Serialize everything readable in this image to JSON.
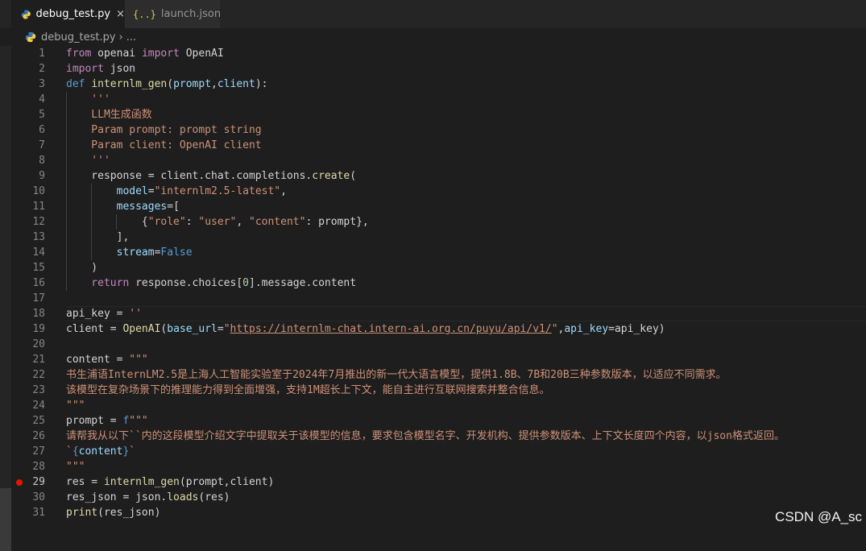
{
  "tabs": [
    {
      "label": "debug_test.py",
      "icon": "python-icon",
      "active": true
    },
    {
      "label": "launch.json",
      "icon": "json-braces-icon",
      "active": false
    }
  ],
  "tab_close_glyph": "×",
  "json_icon_glyph": "{..}",
  "breadcrumb": {
    "file": "debug_test.py",
    "separator": "›",
    "more": "..."
  },
  "colors": {
    "keyword": "#c586c0",
    "builtin_keyword": "#569cd6",
    "function": "#dcdcaa",
    "parameter": "#9cdcfe",
    "string": "#ce9178",
    "number": "#b5cea8",
    "breakpoint": "#e51400"
  },
  "breakpoint_line": 29,
  "current_line": 18,
  "lines": [
    {
      "n": "1",
      "indent": 0,
      "tokens": [
        [
          "kw",
          "from"
        ],
        [
          "",
          ""
        ],
        [
          "",
          "openai "
        ],
        [
          "kw",
          "import"
        ],
        [
          "",
          " OpenAI"
        ]
      ]
    },
    {
      "n": "2",
      "indent": 0,
      "tokens": [
        [
          "kw",
          "import"
        ],
        [
          "",
          " json"
        ]
      ]
    },
    {
      "n": "3",
      "indent": 0,
      "tokens": [
        [
          "kwb",
          "def"
        ],
        [
          "",
          " "
        ],
        [
          "fn",
          "internlm_gen"
        ],
        [
          "",
          "("
        ],
        [
          "par",
          "prompt"
        ],
        [
          "",
          ","
        ],
        [
          "par",
          "client"
        ],
        [
          "",
          "):"
        ]
      ]
    },
    {
      "n": "4",
      "indent": 1,
      "tokens": [
        [
          "str",
          "    '''"
        ]
      ]
    },
    {
      "n": "5",
      "indent": 1,
      "tokens": [
        [
          "str",
          "    LLM生成函数"
        ]
      ]
    },
    {
      "n": "6",
      "indent": 1,
      "tokens": [
        [
          "str",
          "    Param prompt: prompt string"
        ]
      ]
    },
    {
      "n": "7",
      "indent": 1,
      "tokens": [
        [
          "str",
          "    Param client: OpenAI client"
        ]
      ]
    },
    {
      "n": "8",
      "indent": 1,
      "tokens": [
        [
          "str",
          "    '''"
        ]
      ]
    },
    {
      "n": "9",
      "indent": 1,
      "tokens": [
        [
          "",
          "    response = client.chat.completions."
        ],
        [
          "fn",
          "create"
        ],
        [
          "",
          "("
        ]
      ]
    },
    {
      "n": "10",
      "indent": 2,
      "tokens": [
        [
          "",
          "        "
        ],
        [
          "par",
          "model"
        ],
        [
          "",
          "="
        ],
        [
          "str",
          "\"internlm2.5-latest\""
        ],
        [
          "",
          ","
        ]
      ]
    },
    {
      "n": "11",
      "indent": 2,
      "tokens": [
        [
          "",
          "        "
        ],
        [
          "par",
          "messages"
        ],
        [
          "",
          "=["
        ]
      ]
    },
    {
      "n": "12",
      "indent": 3,
      "tokens": [
        [
          "",
          "            {"
        ],
        [
          "str",
          "\"role\""
        ],
        [
          "",
          ": "
        ],
        [
          "str",
          "\"user\""
        ],
        [
          "",
          ", "
        ],
        [
          "str",
          "\"content\""
        ],
        [
          "",
          ": prompt},"
        ]
      ]
    },
    {
      "n": "13",
      "indent": 2,
      "tokens": [
        [
          "",
          "        ],"
        ]
      ]
    },
    {
      "n": "14",
      "indent": 2,
      "tokens": [
        [
          "",
          "        "
        ],
        [
          "par",
          "stream"
        ],
        [
          "",
          "="
        ],
        [
          "kwb",
          "False"
        ]
      ]
    },
    {
      "n": "15",
      "indent": 1,
      "tokens": [
        [
          "",
          "    )"
        ]
      ]
    },
    {
      "n": "16",
      "indent": 1,
      "tokens": [
        [
          "kw",
          "    return"
        ],
        [
          "",
          " response.choices["
        ],
        [
          "num",
          "0"
        ],
        [
          "",
          "].message.content"
        ]
      ]
    },
    {
      "n": "17",
      "indent": 0,
      "tokens": []
    },
    {
      "n": "18",
      "indent": 0,
      "tokens": [
        [
          "",
          "api_key = "
        ],
        [
          "str",
          "''"
        ]
      ]
    },
    {
      "n": "19",
      "indent": 0,
      "tokens": [
        [
          "",
          "client = "
        ],
        [
          "fn",
          "OpenAI"
        ],
        [
          "",
          "("
        ],
        [
          "par",
          "base_url"
        ],
        [
          "",
          "="
        ],
        [
          "str",
          "\""
        ],
        [
          "link",
          "https://internlm-chat.intern-ai.org.cn/puyu/api/v1/"
        ],
        [
          "str",
          "\""
        ],
        [
          "",
          ","
        ],
        [
          "par",
          "api_key"
        ],
        [
          "",
          "=api_key)"
        ]
      ]
    },
    {
      "n": "20",
      "indent": 0,
      "tokens": []
    },
    {
      "n": "21",
      "indent": 0,
      "tokens": [
        [
          "",
          "content = "
        ],
        [
          "str",
          "\"\"\""
        ]
      ]
    },
    {
      "n": "22",
      "indent": 0,
      "tokens": [
        [
          "str",
          "书生浦语InternLM2.5是上海人工智能实验室于2024年7月推出的新一代大语言模型，提供1.8B、7B和20B三种参数版本，以适应不同需求。"
        ]
      ]
    },
    {
      "n": "23",
      "indent": 0,
      "tokens": [
        [
          "str",
          "该模型在复杂场景下的推理能力得到全面增强，支持1M超长上下文，能自主进行互联网搜索并整合信息。"
        ]
      ]
    },
    {
      "n": "24",
      "indent": 0,
      "tokens": [
        [
          "str",
          "\"\"\""
        ]
      ]
    },
    {
      "n": "25",
      "indent": 0,
      "tokens": [
        [
          "",
          "prompt = "
        ],
        [
          "kwb",
          "f"
        ],
        [
          "str",
          "\"\"\""
        ]
      ]
    },
    {
      "n": "26",
      "indent": 0,
      "tokens": [
        [
          "str",
          "请帮我从以下``内的这段模型介绍文字中提取关于该模型的信息，要求包含模型名字、开发机构、提供参数版本、上下文长度四个内容，以json格式返回。"
        ]
      ]
    },
    {
      "n": "27",
      "indent": 0,
      "tokens": [
        [
          "str",
          "`"
        ],
        [
          "kwb",
          "{"
        ],
        [
          "par",
          "content"
        ],
        [
          "kwb",
          "}"
        ],
        [
          "str",
          "`"
        ]
      ]
    },
    {
      "n": "28",
      "indent": 0,
      "tokens": [
        [
          "str",
          "\"\"\""
        ]
      ]
    },
    {
      "n": "29",
      "indent": 0,
      "tokens": [
        [
          "",
          "res = "
        ],
        [
          "fn",
          "internlm_gen"
        ],
        [
          "",
          "(prompt,client)"
        ]
      ]
    },
    {
      "n": "30",
      "indent": 0,
      "tokens": [
        [
          "",
          "res_json = json."
        ],
        [
          "fn",
          "loads"
        ],
        [
          "",
          "(res)"
        ]
      ]
    },
    {
      "n": "31",
      "indent": 0,
      "tokens": [
        [
          "fn",
          "print"
        ],
        [
          "",
          "(res_json)"
        ]
      ]
    }
  ],
  "watermark": "CSDN @A_sc"
}
